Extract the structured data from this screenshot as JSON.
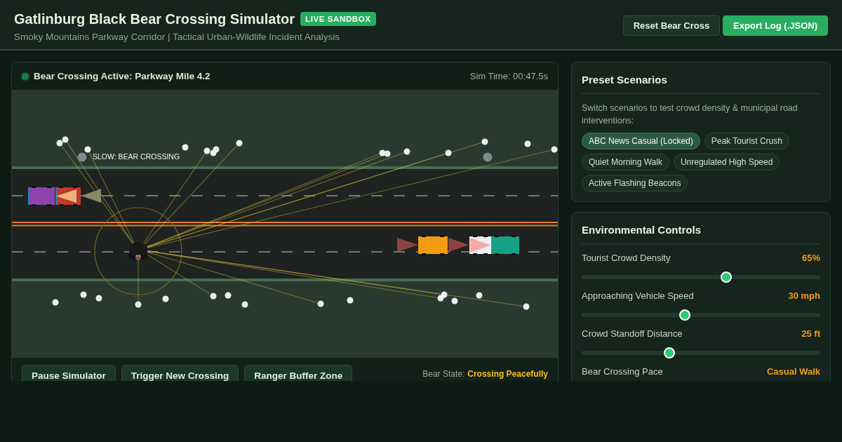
{
  "header": {
    "title": "Gatlinburg Black Bear Crossing Simulator",
    "badge": "LIVE SANDBOX",
    "subtitle": "Smoky Mountains Parkway Corridor | Tactical Urban-Wildlife Incident Analysis",
    "buttons": [
      {
        "label": "Reset Bear Cross",
        "kind": "secondary"
      },
      {
        "label": "Export Log (.JSON)",
        "kind": "primary"
      }
    ]
  },
  "simulator": {
    "title": "Bear Crossing Active: Parkway Mile 4.2",
    "sim_time": "Sim Time: 00:47.5s",
    "sign_label": "SLOW: BEAR CROSSING",
    "buttons": [
      "Pause Simulator",
      "Trigger New Crossing",
      "Ranger Buffer Zone"
    ],
    "bear_state_label": "Bear State:",
    "bear_state": "Crossing Peacefully"
  },
  "presets": {
    "title": "Preset Scenarios",
    "description": "Switch scenarios to test crowd density & municipal road interventions:",
    "scenarios": [
      {
        "label": "ABC News Casual (Locked)",
        "selected": true
      },
      {
        "label": "Peak Tourist Crush",
        "selected": false
      },
      {
        "label": "Quiet Morning Walk",
        "selected": false
      },
      {
        "label": "Unregulated High Speed",
        "selected": false
      },
      {
        "label": "Active Flashing Beacons",
        "selected": false
      }
    ]
  },
  "controls": {
    "title": "Environmental Controls",
    "sliders": [
      {
        "label": "Tourist Crowd Density",
        "value": "65%",
        "level": 0.61
      },
      {
        "label": "Approaching Vehicle Speed",
        "value": "30 mph",
        "level": 0.43
      },
      {
        "label": "Crowd Standoff Distance",
        "value": "25 ft",
        "level": 0.36
      },
      {
        "label": "Bear Crossing Pace",
        "value": "Casual Walk"
      }
    ]
  }
}
